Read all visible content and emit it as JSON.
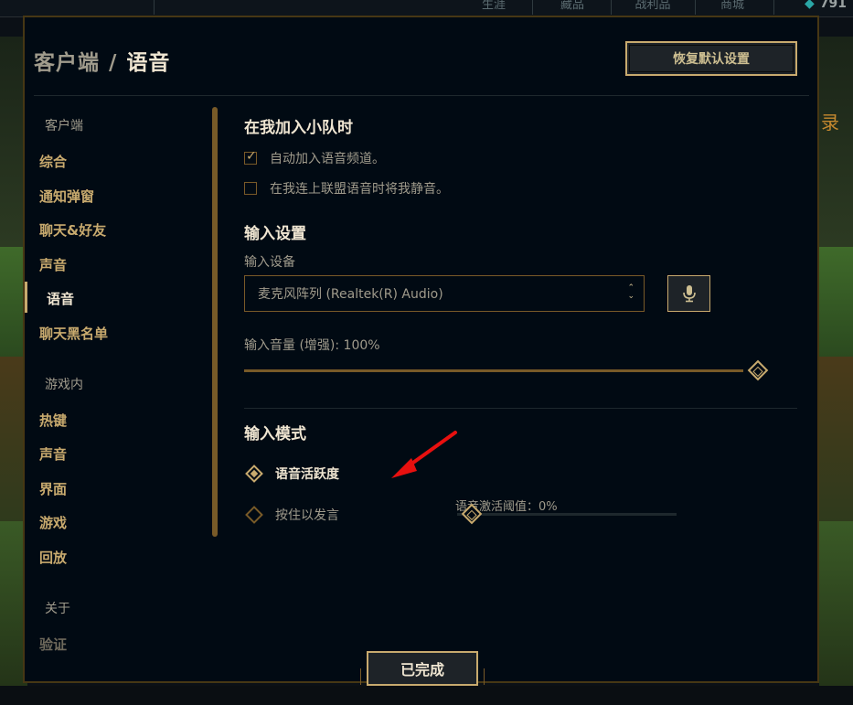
{
  "background": {
    "tabs": [
      "生涯",
      "藏品",
      "战利品",
      "商城"
    ],
    "top_right": "791",
    "side_text": "录"
  },
  "dialog": {
    "breadcrumb": {
      "parent": "客户端",
      "separator": "/",
      "current": "语音"
    },
    "reset_label": "恢复默认设置",
    "done_label": "已完成"
  },
  "sidebar": {
    "groups": [
      {
        "title": "客户端",
        "items": [
          "综合",
          "通知弹窗",
          "聊天&好友",
          "声音",
          "语音",
          "聊天黑名单"
        ]
      },
      {
        "title": "游戏内",
        "items": [
          "热键",
          "声音",
          "界面",
          "游戏",
          "回放"
        ]
      },
      {
        "title": "关于",
        "items": [
          "验证"
        ]
      }
    ],
    "active_item": "语音"
  },
  "content": {
    "party_section": {
      "title": "在我加入小队时",
      "options": [
        {
          "label": "自动加入语音频道。",
          "checked": true
        },
        {
          "label": "在我连上联盟语音时将我静音。",
          "checked": false
        }
      ]
    },
    "input_settings": {
      "title": "输入设置",
      "device_label": "输入设备",
      "device_value": "麦克风阵列 (Realtek(R) Audio)",
      "volume_label": "输入音量 (增强): 100%",
      "volume_level": 1.0
    },
    "input_mode": {
      "title": "输入模式",
      "options": [
        {
          "label": "语音活跃度",
          "selected": true
        },
        {
          "label": "按住以发言",
          "selected": false
        }
      ],
      "threshold_label": "语音激活阈值：0%",
      "threshold_level": 0.0
    }
  },
  "icons": {
    "mic": "microphone-icon",
    "checkbox": "check-icon",
    "dropdown": "chevron-up-down-icon",
    "annotation": "red-arrow-annotation"
  },
  "colors": {
    "gold": "#c8aa6e",
    "gold_dark": "#785a28",
    "text_light": "#f0e6d2",
    "text_muted": "#a09b8c",
    "bg": "#010a13",
    "arrow": "#e8100f"
  }
}
